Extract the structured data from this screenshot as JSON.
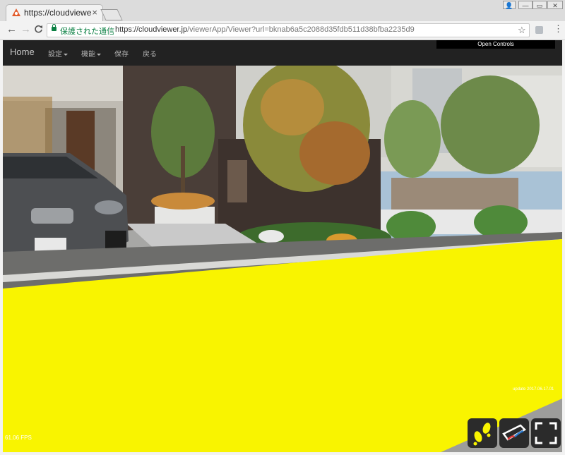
{
  "browser": {
    "tab_title": "https://cloudviewer.jp",
    "tab_close": "×",
    "secure_label": "保護された通信",
    "url_host": "https://cloudviewer.jp",
    "url_path": "/viewerApp/Viewer?url=bknab6a5c2088d35fdb511d38bfba2235d9",
    "back_glyph": "←",
    "forward_glyph": "→",
    "reload_glyph": "C",
    "star_glyph": "☆",
    "menu_glyph": "⋮",
    "window_controls": [
      "👤",
      "—",
      "▭",
      "✕"
    ]
  },
  "app_nav": {
    "brand": "Home",
    "items": [
      "設定",
      "機能",
      "保存",
      "戻る"
    ],
    "open_controls": "Open Controls"
  },
  "overlay": {
    "update_text": "update 2017.06.17.01",
    "fps_text": "61.06 FPS"
  },
  "controls": {
    "icons": [
      "footsteps-icon",
      "vr-goggles-icon",
      "fullscreen-icon"
    ]
  },
  "colors": {
    "highlight": "#f9f400",
    "nav_bg": "#222222",
    "secure_green": "#0b8043"
  }
}
